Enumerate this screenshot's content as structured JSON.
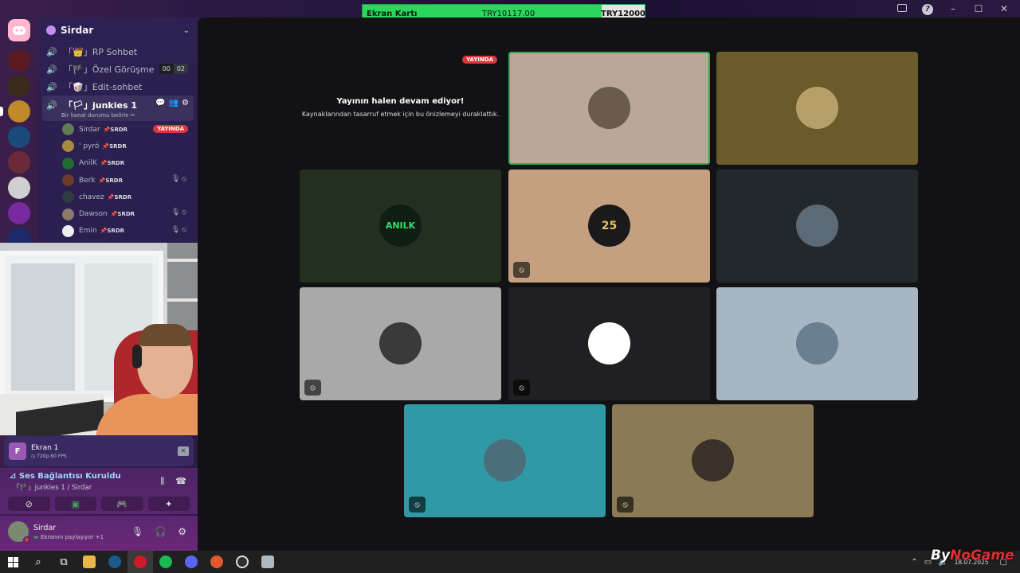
{
  "overlay": {
    "item_label": "Ekran Kartı",
    "current_amount": "TRY10117.00",
    "goal_amount": "TRY12000",
    "progress": 0.843
  },
  "server": {
    "name": "Sirdar",
    "voice_channels": [
      {
        "label": "「👑」RP Sohbet"
      },
      {
        "label": "「🏴」Özel Görüşme",
        "count_a": "00",
        "count_b": "02"
      },
      {
        "label": "「🥡」Edit-sohbet"
      }
    ],
    "active_channel": {
      "label": "「🏳」junkies 1",
      "status_placeholder": "Bir kanal durumu belirle ✏"
    },
    "members": [
      {
        "name": "Sirdar",
        "tag": "📌SRDR",
        "live": "YAYINDA",
        "color": "#5f7b55"
      },
      {
        "name": "' pyró",
        "tag": "📌SRDR",
        "color": "#a98b3d"
      },
      {
        "name": "AnilK",
        "tag": "📌SRDR",
        "color": "#1e6b34"
      },
      {
        "name": "Berk",
        "tag": "📌SRDR",
        "muted": true,
        "color": "#6b3a2a"
      },
      {
        "name": "chavez",
        "tag": "📌SRDR",
        "color": "#2e3b40"
      },
      {
        "name": "Dawson",
        "tag": "📌SRDR",
        "muted": true,
        "color": "#8a7a6a"
      },
      {
        "name": "Emin",
        "tag": "📌SRDR",
        "muted": true,
        "color": "#eeeeee"
      }
    ]
  },
  "stream_panel": {
    "thumb_letter": "F",
    "name": "Ekran 1",
    "meta": "◷ 720p 60 FPS"
  },
  "voice": {
    "status": "Ses Bağlantısı Kuruldu",
    "location": "「🏴」junkies 1 / Sirdar"
  },
  "user": {
    "name": "Sirdar",
    "status": "Ekranını paylaşıyor +1"
  },
  "stage": {
    "paused": {
      "badge": "YAYINDA",
      "title": "Yayının halen devam ediyor!",
      "subtitle": "Kaynaklarından tasarruf etmek için bu önizlemeyi duraklattık."
    },
    "tiles": [
      {
        "id": "t1",
        "bg": "#b9a898",
        "avatar": "#6b5a4e",
        "speaking": true
      },
      {
        "id": "t2",
        "bg": "#6b5b2a",
        "avatar": "#b6a06a"
      },
      {
        "id": "t3",
        "bg": "#23301f",
        "avatar": "#0f1e12",
        "avatar_text": "ANILK"
      },
      {
        "id": "t4",
        "bg": "#c4a080",
        "avatar": "#1a1a1a",
        "avatar_text": "25",
        "mic_off": true
      },
      {
        "id": "t5",
        "bg": "#23282d",
        "avatar": "#5c6a75"
      },
      {
        "id": "t6",
        "bg": "#a9a9a9",
        "avatar": "#3a3a3a",
        "mic_off": true
      },
      {
        "id": "t7",
        "bg": "#202022",
        "avatar": "#ffffff",
        "mic_off": true
      },
      {
        "id": "t8",
        "bg": "#a8b6c4",
        "avatar": "#6a7f92"
      },
      {
        "id": "t9",
        "bg": "#2f9aa5",
        "avatar": "#4a6e7a",
        "mic_off": true
      },
      {
        "id": "t10",
        "bg": "#8a7a55",
        "avatar": "#3a3228",
        "mic_off": true
      }
    ]
  },
  "taskbar": {
    "date": "18.07.2025"
  },
  "watermark": {
    "a": "By",
    "b": "NoGame"
  }
}
